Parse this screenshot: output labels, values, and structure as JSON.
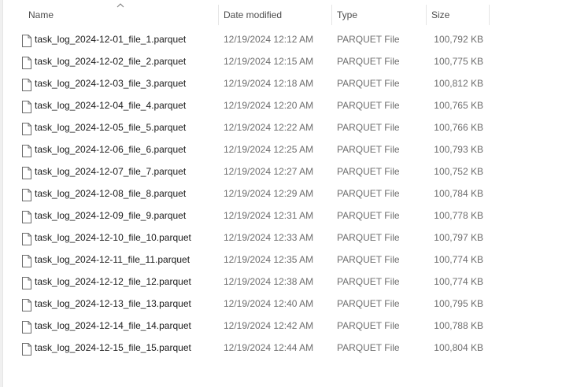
{
  "columns": {
    "name": "Name",
    "date": "Date modified",
    "type": "Type",
    "size": "Size"
  },
  "files": [
    {
      "name": "task_log_2024-12-01_file_1.parquet",
      "date": "12/19/2024 12:12 AM",
      "type": "PARQUET File",
      "size": "100,792 KB"
    },
    {
      "name": "task_log_2024-12-02_file_2.parquet",
      "date": "12/19/2024 12:15 AM",
      "type": "PARQUET File",
      "size": "100,775 KB"
    },
    {
      "name": "task_log_2024-12-03_file_3.parquet",
      "date": "12/19/2024 12:18 AM",
      "type": "PARQUET File",
      "size": "100,812 KB"
    },
    {
      "name": "task_log_2024-12-04_file_4.parquet",
      "date": "12/19/2024 12:20 AM",
      "type": "PARQUET File",
      "size": "100,765 KB"
    },
    {
      "name": "task_log_2024-12-05_file_5.parquet",
      "date": "12/19/2024 12:22 AM",
      "type": "PARQUET File",
      "size": "100,766 KB"
    },
    {
      "name": "task_log_2024-12-06_file_6.parquet",
      "date": "12/19/2024 12:25 AM",
      "type": "PARQUET File",
      "size": "100,793 KB"
    },
    {
      "name": "task_log_2024-12-07_file_7.parquet",
      "date": "12/19/2024 12:27 AM",
      "type": "PARQUET File",
      "size": "100,752 KB"
    },
    {
      "name": "task_log_2024-12-08_file_8.parquet",
      "date": "12/19/2024 12:29 AM",
      "type": "PARQUET File",
      "size": "100,784 KB"
    },
    {
      "name": "task_log_2024-12-09_file_9.parquet",
      "date": "12/19/2024 12:31 AM",
      "type": "PARQUET File",
      "size": "100,778 KB"
    },
    {
      "name": "task_log_2024-12-10_file_10.parquet",
      "date": "12/19/2024 12:33 AM",
      "type": "PARQUET File",
      "size": "100,797 KB"
    },
    {
      "name": "task_log_2024-12-11_file_11.parquet",
      "date": "12/19/2024 12:35 AM",
      "type": "PARQUET File",
      "size": "100,774 KB"
    },
    {
      "name": "task_log_2024-12-12_file_12.parquet",
      "date": "12/19/2024 12:38 AM",
      "type": "PARQUET File",
      "size": "100,774 KB"
    },
    {
      "name": "task_log_2024-12-13_file_13.parquet",
      "date": "12/19/2024 12:40 AM",
      "type": "PARQUET File",
      "size": "100,795 KB"
    },
    {
      "name": "task_log_2024-12-14_file_14.parquet",
      "date": "12/19/2024 12:42 AM",
      "type": "PARQUET File",
      "size": "100,788 KB"
    },
    {
      "name": "task_log_2024-12-15_file_15.parquet",
      "date": "12/19/2024 12:44 AM",
      "type": "PARQUET File",
      "size": "100,804 KB"
    }
  ],
  "icons": {
    "file": "file-icon",
    "sort": "sort-ascending-icon"
  }
}
